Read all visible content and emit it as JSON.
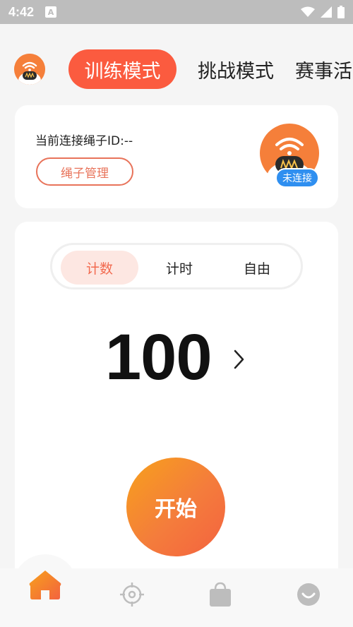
{
  "status_bar": {
    "time": "4:42",
    "notification_icon_label": "A"
  },
  "header": {
    "tabs": [
      {
        "label": "训练模式",
        "active": true
      },
      {
        "label": "挑战模式",
        "active": false
      },
      {
        "label": "赛事活",
        "active": false
      }
    ]
  },
  "rope_card": {
    "id_text": "当前连接绳子ID:--",
    "manage_label": "绳子管理",
    "connection_status": "未连接"
  },
  "mode_selector": {
    "options": [
      {
        "label": "计数",
        "active": true
      },
      {
        "label": "计时",
        "active": false
      },
      {
        "label": "自由",
        "active": false
      }
    ]
  },
  "counter": {
    "value": "100"
  },
  "start_label": "开始",
  "bottom_nav": {
    "items": [
      {
        "icon": "home-icon",
        "active": true
      },
      {
        "icon": "target-icon",
        "active": false
      },
      {
        "icon": "shopping-bag-icon",
        "active": false
      },
      {
        "icon": "smile-face-icon",
        "active": false
      }
    ]
  },
  "colors": {
    "accent": "#fb5b3f",
    "accent_light": "#fde7e2",
    "badge_blue": "#2f8ff0",
    "status_bar": "#bdbdbd",
    "start_gradient": [
      "#f7a11c",
      "#f3623f"
    ]
  }
}
